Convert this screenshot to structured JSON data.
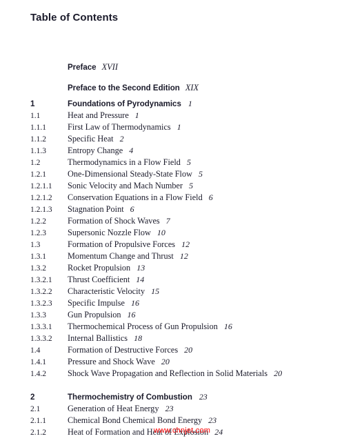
{
  "page": {
    "title": "Table of Contents",
    "background_color": "#ffffff",
    "text_color": "#1b1b2b"
  },
  "watermark": {
    "text": "www.chnjet.com",
    "color": "#fe0000"
  },
  "front_matter": [
    {
      "num": "",
      "title": "Preface",
      "page": "XVII"
    },
    {
      "num": "",
      "title": "Preface to the Second Edition",
      "page": "XIX"
    }
  ],
  "entries": [
    {
      "num": "1",
      "title": "Foundations of Pyrodynamics",
      "page": "1",
      "level": "chapter",
      "spacer_before": false
    },
    {
      "num": "1.1",
      "title": "Heat and Pressure",
      "page": "1",
      "level": "section",
      "spacer_before": false
    },
    {
      "num": "1.1.1",
      "title": "First Law of Thermodynamics",
      "page": "1",
      "level": "section",
      "spacer_before": false
    },
    {
      "num": "1.1.2",
      "title": "Specific Heat",
      "page": "2",
      "level": "section",
      "spacer_before": false
    },
    {
      "num": "1.1.3",
      "title": "Entropy Change",
      "page": "4",
      "level": "section",
      "spacer_before": false
    },
    {
      "num": "1.2",
      "title": "Thermodynamics in a Flow Field",
      "page": "5",
      "level": "section",
      "spacer_before": false
    },
    {
      "num": "1.2.1",
      "title": "One-Dimensional Steady-State Flow",
      "page": "5",
      "level": "section",
      "spacer_before": false
    },
    {
      "num": "1.2.1.1",
      "title": "Sonic Velocity and Mach Number",
      "page": "5",
      "level": "section",
      "spacer_before": false
    },
    {
      "num": "1.2.1.2",
      "title": "Conservation Equations in a Flow Field",
      "page": "6",
      "level": "section",
      "spacer_before": false
    },
    {
      "num": "1.2.1.3",
      "title": "Stagnation Point",
      "page": "6",
      "level": "section",
      "spacer_before": false
    },
    {
      "num": "1.2.2",
      "title": "Formation of Shock Waves",
      "page": "7",
      "level": "section",
      "spacer_before": false
    },
    {
      "num": "1.2.3",
      "title": "Supersonic Nozzle Flow",
      "page": "10",
      "level": "section",
      "spacer_before": false
    },
    {
      "num": "1.3",
      "title": "Formation of Propulsive Forces",
      "page": "12",
      "level": "section",
      "spacer_before": false
    },
    {
      "num": "1.3.1",
      "title": "Momentum Change and Thrust",
      "page": "12",
      "level": "section",
      "spacer_before": false
    },
    {
      "num": "1.3.2",
      "title": "Rocket Propulsion",
      "page": "13",
      "level": "section",
      "spacer_before": false
    },
    {
      "num": "1.3.2.1",
      "title": "Thrust Coefficient",
      "page": "14",
      "level": "section",
      "spacer_before": false
    },
    {
      "num": "1.3.2.2",
      "title": "Characteristic Velocity",
      "page": "15",
      "level": "section",
      "spacer_before": false
    },
    {
      "num": "1.3.2.3",
      "title": "Specific Impulse",
      "page": "16",
      "level": "section",
      "spacer_before": false
    },
    {
      "num": "1.3.3",
      "title": "Gun Propulsion",
      "page": "16",
      "level": "section",
      "spacer_before": false
    },
    {
      "num": "1.3.3.1",
      "title": "Thermochemical Process of Gun Propulsion",
      "page": "16",
      "level": "section",
      "spacer_before": false
    },
    {
      "num": "1.3.3.2",
      "title": "Internal Ballistics",
      "page": "18",
      "level": "section",
      "spacer_before": false
    },
    {
      "num": "1.4",
      "title": "Formation of Destructive Forces",
      "page": "20",
      "level": "section",
      "spacer_before": false
    },
    {
      "num": "1.4.1",
      "title": "Pressure and Shock Wave",
      "page": "20",
      "level": "section",
      "spacer_before": false
    },
    {
      "num": "1.4.2",
      "title": "Shock Wave Propagation and Reflection in Solid Materials",
      "page": "20",
      "level": "section",
      "spacer_before": false
    },
    {
      "num": "2",
      "title": "Thermochemistry of Combustion",
      "page": "23",
      "level": "chapter",
      "spacer_before": true
    },
    {
      "num": "2.1",
      "title": "Generation of Heat Energy",
      "page": "23",
      "level": "section",
      "spacer_before": false
    },
    {
      "num": "2.1.1",
      "title": "Chemical Bond Chemical Bond Energy",
      "page": "23",
      "level": "section",
      "spacer_before": false
    },
    {
      "num": "2.1.2",
      "title": "Heat of Formation and Heat of Explosion",
      "page": "24",
      "level": "section",
      "spacer_before": false
    }
  ]
}
